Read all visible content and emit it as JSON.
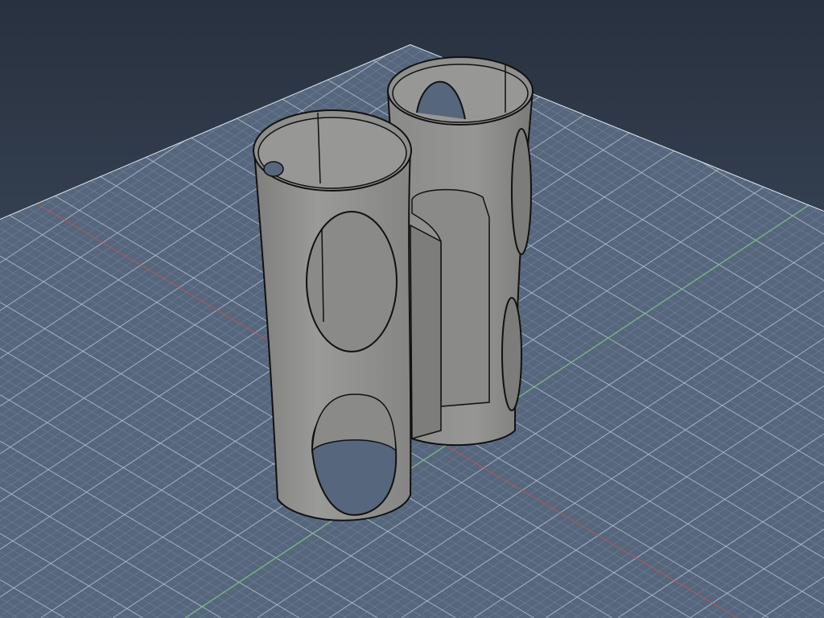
{
  "viewport": {
    "background_top": "#2a3342",
    "background_bottom": "#46546a",
    "grid_fill": "#56667c",
    "grid_minor": "#8696ac",
    "grid_major": "#b8c4d4",
    "axis_x_color": "#c0504d",
    "axis_y_color": "#4fb04f",
    "model_color": "#8d8d8b",
    "edge_color": "#111111"
  }
}
